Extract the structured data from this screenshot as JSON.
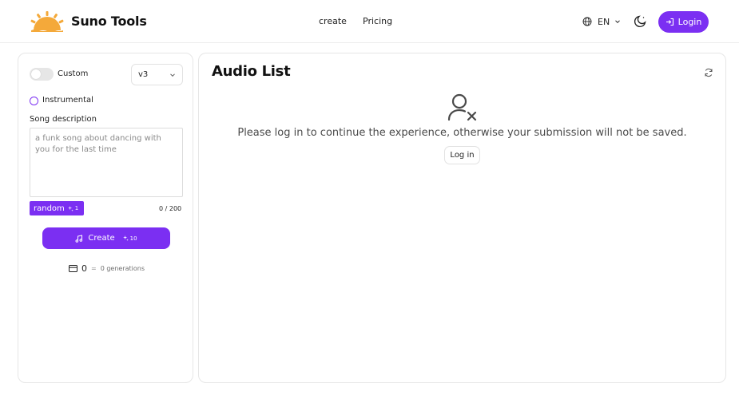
{
  "app": {
    "name": "Suno Tools"
  },
  "nav": {
    "create": "create",
    "pricing": "Pricing"
  },
  "header": {
    "language": "EN",
    "login": "Login"
  },
  "colors": {
    "accent": "#7b2ff2",
    "logo_sun": "#f4a93a",
    "border": "#e6e6e6"
  },
  "icons": {
    "logo": "sun-logo-icon",
    "globe": "globe-icon",
    "chevron": "chevron-down-icon",
    "theme": "moon-icon",
    "login": "login-icon",
    "sparkle": "sparkle-icon",
    "music": "music-note-icon",
    "card": "credit-card-icon",
    "refresh": "refresh-icon",
    "user_x": "user-x-icon"
  },
  "form": {
    "custom_label": "Custom",
    "custom_enabled": false,
    "version": "v3",
    "instrumental_label": "Instrumental",
    "instrumental_checked": false,
    "song_description_label": "Song description",
    "song_description_placeholder": "a funk song about dancing with you for the last time",
    "song_description_value": "",
    "random_label": "random",
    "random_cost": "1",
    "char_count": "0 / 200",
    "create_label": "Create",
    "create_cost": "10",
    "credits": "0",
    "credits_eq": "=",
    "generations": "0 generations"
  },
  "audio_list": {
    "title": "Audio List",
    "login_message": "Please log in to continue the experience, otherwise your submission will not be saved.",
    "login_button": "Log in"
  }
}
